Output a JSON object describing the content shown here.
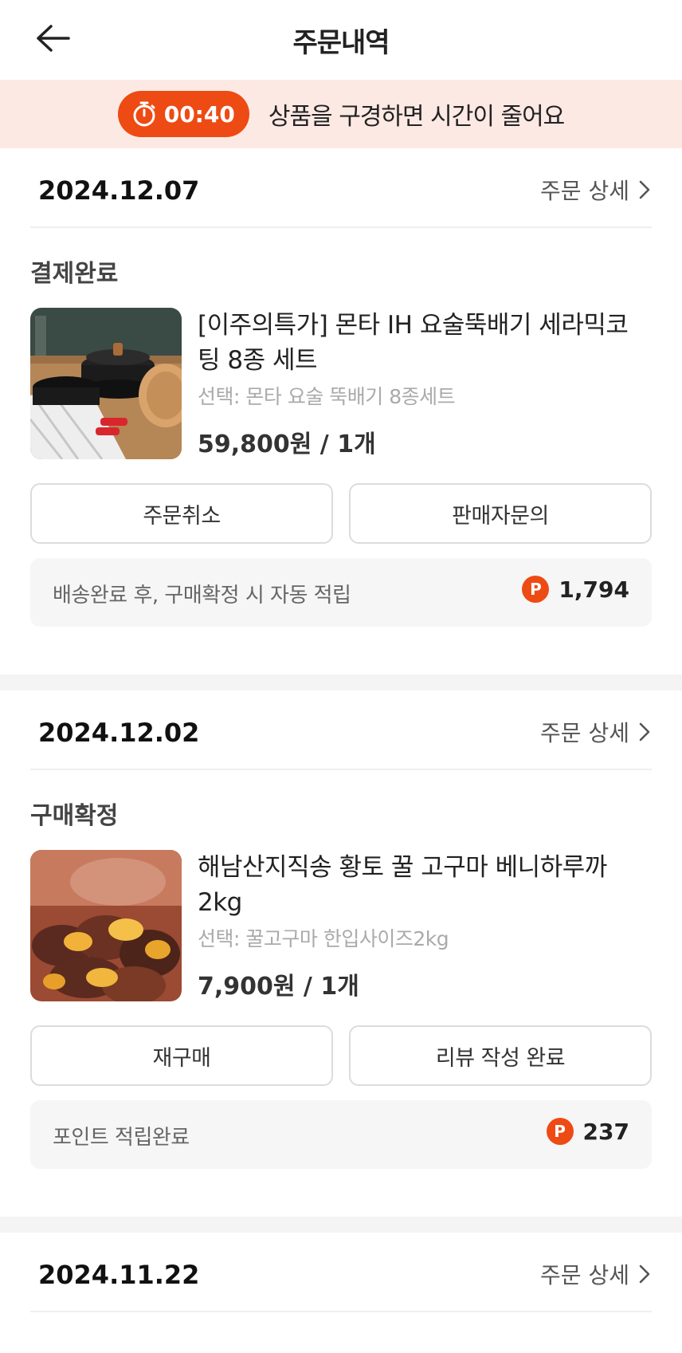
{
  "header": {
    "title": "주문내역",
    "back_icon": "arrow-left-icon"
  },
  "timer_banner": {
    "time": "00:40",
    "message": "상품을 구경하면 시간이 줄어요",
    "accent": "#ee4a14",
    "background": "#fde9e4"
  },
  "orders": [
    {
      "date": "2024.12.07",
      "detail_label": "주문 상세",
      "status": "결제완료",
      "product_name": "[이주의특가] 몬타 IH 요술뚝배기 세라믹코팅 8종 세트",
      "option": "선택: 몬타 요술 뚝배기 8종세트",
      "price": "59,800원 / 1개",
      "button_left": "주문취소",
      "button_right": "판매자문의",
      "points_text": "배송완료 후, 구매확정 시 자동 적립",
      "points_value": "1,794"
    },
    {
      "date": "2024.12.02",
      "detail_label": "주문 상세",
      "status": "구매확정",
      "product_name": "해남산지직송 황토 꿀 고구마 베니하루까 2kg",
      "option": "선택: 꿀고구마 한입사이즈2kg",
      "price": "7,900원 / 1개",
      "button_left": "재구매",
      "button_right": "리뷰 작성 완료",
      "points_text": "포인트 적립완료",
      "points_value": "237"
    },
    {
      "date": "2024.11.22",
      "detail_label": "주문 상세"
    }
  ],
  "point_badge_label": "P"
}
